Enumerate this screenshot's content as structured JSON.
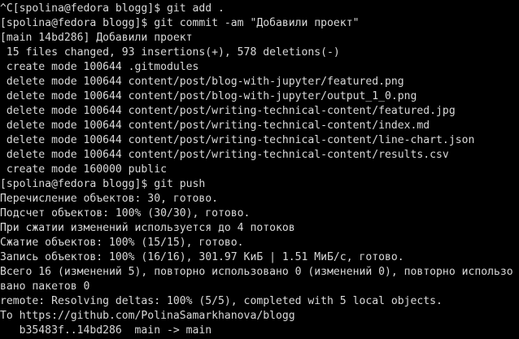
{
  "terminal": {
    "lines": [
      "^C[spolina@fedora blogg]$ git add .",
      "[spolina@fedora blogg]$ git commit -am \"Добавили проект\"",
      "[main 14bd286] Добавили проект",
      " 15 files changed, 93 insertions(+), 578 deletions(-)",
      " create mode 100644 .gitmodules",
      " delete mode 100644 content/post/blog-with-jupyter/featured.png",
      " delete mode 100644 content/post/blog-with-jupyter/output_1_0.png",
      " delete mode 100644 content/post/writing-technical-content/featured.jpg",
      " delete mode 100644 content/post/writing-technical-content/index.md",
      " delete mode 100644 content/post/writing-technical-content/line-chart.json",
      " delete mode 100644 content/post/writing-technical-content/results.csv",
      " create mode 160000 public",
      "[spolina@fedora blogg]$ git push",
      "Перечисление объектов: 30, готово.",
      "Подсчет объектов: 100% (30/30), готово.",
      "При сжатии изменений используется до 4 потоков",
      "Сжатие объектов: 100% (15/15), готово.",
      "Запись объектов: 100% (16/16), 301.97 КиБ | 1.51 МиБ/с, готово.",
      "Всего 16 (изменений 5), повторно использовано 0 (изменений 0), повторно использо",
      "вано пакетов 0",
      "remote: Resolving deltas: 100% (5/5), completed with 5 local objects.",
      "To https://github.com/PolinaSamarkhanova/blogg",
      "   b35483f..14bd286  main -> main"
    ]
  }
}
